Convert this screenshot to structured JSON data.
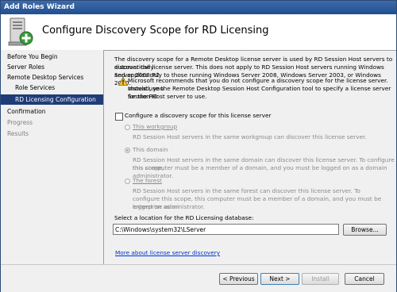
{
  "window": {
    "title": "Add Roles Wizard"
  },
  "header": {
    "title": "Configure Discovery Scope for RD Licensing",
    "icon": "server-add-icon"
  },
  "sidebar": {
    "items": [
      {
        "label": "Before You Begin",
        "state": "normal"
      },
      {
        "label": "Server Roles",
        "state": "normal"
      },
      {
        "label": "Remote Desktop Services",
        "state": "normal"
      },
      {
        "label": "Role Services",
        "state": "normal"
      },
      {
        "label": "RD Licensing Configuration",
        "state": "selected"
      },
      {
        "label": "Confirmation",
        "state": "normal"
      },
      {
        "label": "Progress",
        "state": "disabled"
      },
      {
        "label": "Results",
        "state": "disabled"
      }
    ]
  },
  "main": {
    "intro_lines": [
      "The discovery scope for a Remote Desktop license server is used by RD Session Host servers to automatically",
      "discover the license server. This does not apply to RD Session Host servers running Windows Server 2008 R2",
      "and applies only to those running Windows Server 2008, Windows Server 2003, or Windows 2000."
    ],
    "warning_lines": [
      "Microsoft recommends that you do not configure a discovery scope for the license server. Instead, you",
      "should use the Remote Desktop Session Host Configuration tool to specify a license server for the RD",
      "Session Host server to use."
    ],
    "checkbox_label": "Configure a discovery scope for this license server",
    "checkbox_checked": false,
    "options": {
      "workgroup": {
        "label": "This workgroup",
        "desc": [
          "RD Session Host servers in the same workgroup can discover this license server."
        ],
        "checked": false
      },
      "domain": {
        "label": "This domain",
        "desc": [
          "RD Session Host servers in the same domain can discover this license server. To configure this scope,",
          "this computer must be a member of a domain, and you must be logged on as a domain administrator."
        ],
        "checked": true
      },
      "forest": {
        "label": "The forest",
        "desc": [
          "RD Session Host servers in the same forest can discover this license server. To",
          "configure this scope, this computer must be a member of a domain, and you must be logged on as an",
          "enterprise administrator."
        ],
        "checked": false
      }
    },
    "location_label": "Select a location for the RD Licensing database:",
    "location_value": "C:\\Windows\\system32\\LServer",
    "browse_label": "Browse...",
    "more_link": "More about license server discovery"
  },
  "footer": {
    "previous_label": "< Previous",
    "next_label": "Next >",
    "install_label": "Install",
    "cancel_label": "Cancel"
  },
  "colors": {
    "selected_nav": "#1f3c78",
    "titlebar": "#2b5797",
    "link": "#0033cc"
  }
}
